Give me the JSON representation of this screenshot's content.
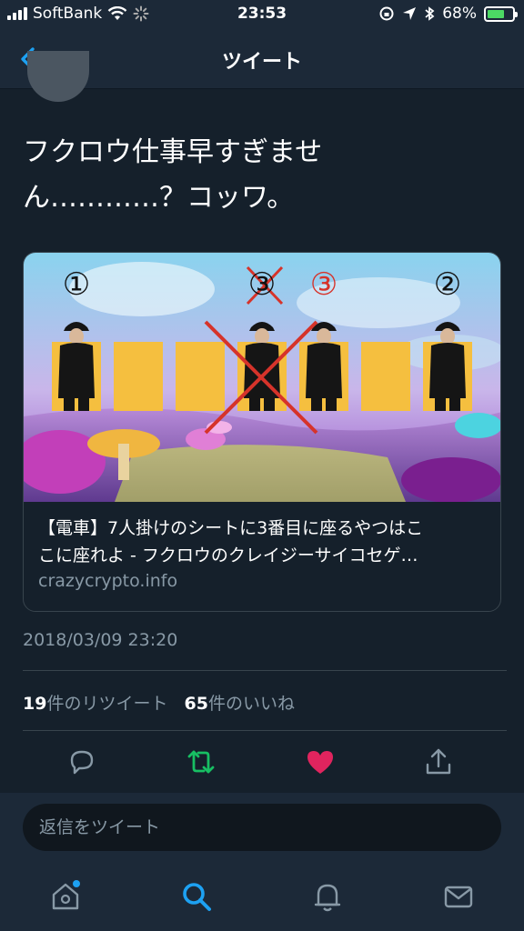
{
  "status": {
    "carrier": "SoftBank",
    "time": "23:53",
    "battery": "68%",
    "battery_level": 0.68
  },
  "nav": {
    "title": "ツイート"
  },
  "tweet": {
    "text_line1": "フクロウ仕事早すぎませ",
    "text_line2": "ん…………？コッワ。",
    "timestamp": "2018/03/09 23:20",
    "retweets": "19",
    "retweets_label": "件のリツイート",
    "likes": "65",
    "likes_label": "件のいいね"
  },
  "card": {
    "title_line1": "【電車】7人掛けのシートに3番目に座るやつはこ",
    "title_line2": "こに座れよ - フクロウのクレイジーサイコセゲ…",
    "domain": "crazycrypto.info",
    "image_labels": [
      "①",
      "③",
      "③",
      "②"
    ]
  },
  "reply": {
    "placeholder": "返信をツイート"
  },
  "colors": {
    "background": "#15202b",
    "bar": "#1c2938",
    "accent": "#1da1f2",
    "retweet": "#17bf63",
    "like": "#e0245e",
    "muted": "#8899a6"
  },
  "icons": [
    "back-icon",
    "reply-icon",
    "retweet-icon",
    "like-icon",
    "share-icon",
    "home-icon",
    "search-icon",
    "notifications-icon",
    "messages-icon"
  ]
}
